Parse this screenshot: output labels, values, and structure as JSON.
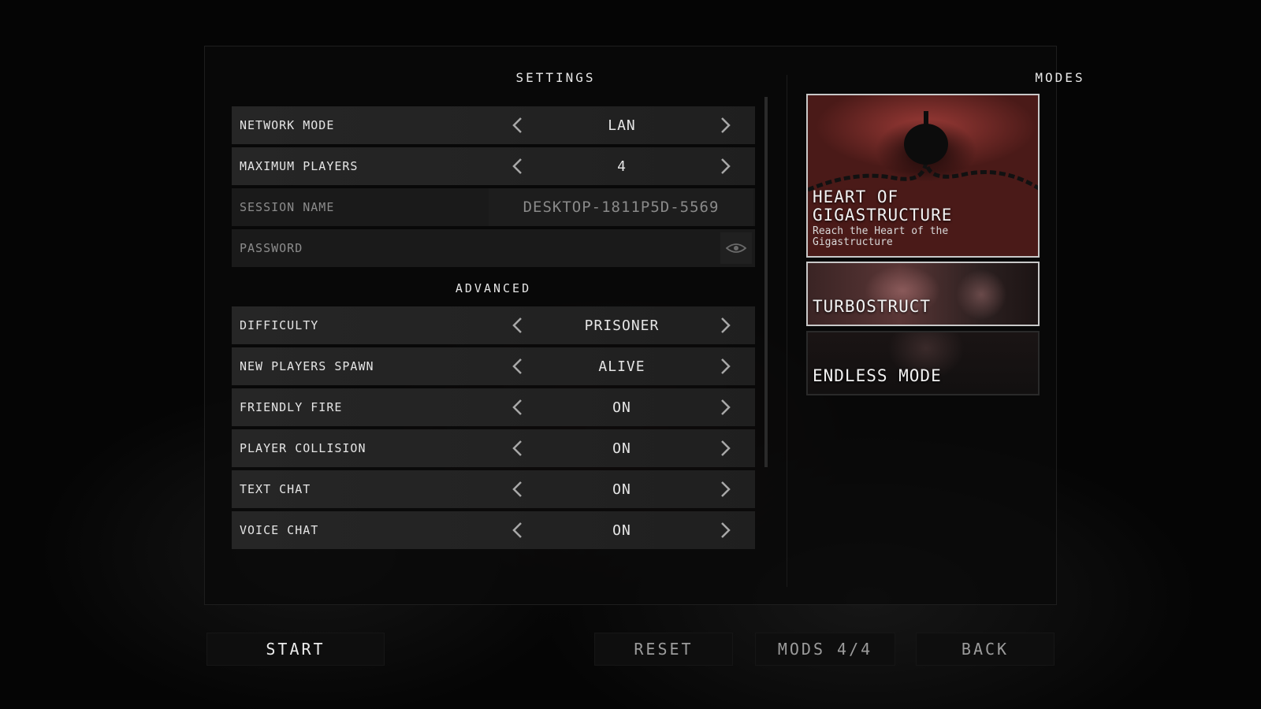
{
  "settings": {
    "title": "SETTINGS",
    "rows": [
      {
        "label": "NETWORK MODE",
        "value": "LAN"
      },
      {
        "label": "MAXIMUM PLAYERS",
        "value": "4"
      }
    ],
    "session_name": {
      "label": "SESSION NAME",
      "value": "DESKTOP-1811P5D-5569"
    },
    "password": {
      "label": "PASSWORD",
      "value": ""
    },
    "advanced_title": "ADVANCED",
    "advanced_rows": [
      {
        "label": "DIFFICULTY",
        "value": "PRISONER"
      },
      {
        "label": "NEW PLAYERS SPAWN",
        "value": "ALIVE"
      },
      {
        "label": "FRIENDLY FIRE",
        "value": "ON"
      },
      {
        "label": "PLAYER COLLISION",
        "value": "ON"
      },
      {
        "label": "TEXT CHAT",
        "value": "ON"
      },
      {
        "label": "VOICE CHAT",
        "value": "ON"
      }
    ]
  },
  "modes": {
    "title": "MODES",
    "items": [
      {
        "title": "HEART OF GIGASTRUCTURE",
        "description": "Reach the Heart of the Gigastructure",
        "selected": true
      },
      {
        "title": "TURBOSTRUCT",
        "description": "",
        "selected": false
      },
      {
        "title": "ENDLESS MODE",
        "description": "",
        "selected": false
      }
    ]
  },
  "footer": {
    "start_label": "START",
    "reset_label": "RESET",
    "mods_label": "MODS 4/4",
    "back_label": "BACK"
  },
  "icons": {
    "arrow_left": "chevron-left-icon",
    "arrow_right": "chevron-right-icon",
    "password_toggle": "eye-icon"
  },
  "colors": {
    "selected_border": "#c8c8c8",
    "row_background": "#262626",
    "text": "#e6e6e6",
    "dim_text": "#8c8c8c"
  }
}
